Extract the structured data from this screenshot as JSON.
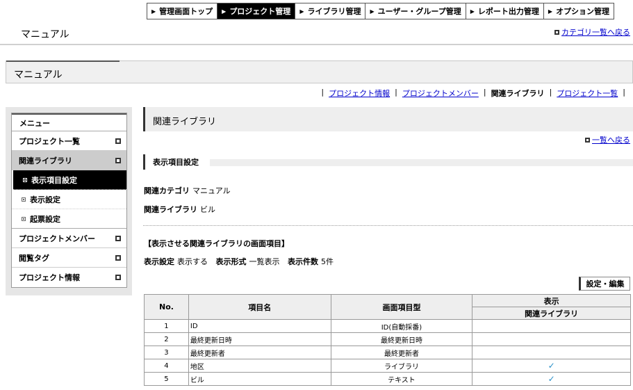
{
  "topnav": [
    {
      "label": "管理画面トップ",
      "active": false
    },
    {
      "label": "プロジェクト管理",
      "active": true
    },
    {
      "label": "ライブラリ管理",
      "active": false
    },
    {
      "label": "ユーザー・グループ管理",
      "active": false
    },
    {
      "label": "レポート出力管理",
      "active": false
    },
    {
      "label": "オプション管理",
      "active": false
    }
  ],
  "header": {
    "title": "マニュアル",
    "back_link": "カテゴリ一覧へ戻る"
  },
  "page_bar": {
    "title": "マニュアル"
  },
  "subnav": {
    "items": [
      {
        "label": "プロジェクト情報",
        "current": false
      },
      {
        "label": "プロジェクトメンバー",
        "current": false
      },
      {
        "label": "関連ライブラリ",
        "current": true
      },
      {
        "label": "プロジェクト一覧",
        "current": false
      }
    ],
    "separator": "|"
  },
  "sidebar": {
    "menu_title": "メニュー",
    "item_project_list": "プロジェクト一覧",
    "item_related_library": "関連ライブラリ",
    "sub_display_items": "表示項目設定",
    "sub_display_settings": "表示設定",
    "sub_ticket_settings": "起票設定",
    "item_project_member": "プロジェクトメンバー",
    "item_browse_tag": "閲覧タグ",
    "item_project_info": "プロジェクト情報"
  },
  "main": {
    "title": "関連ライブラリ",
    "back_link": "一覧へ戻る",
    "section_title": "表示項目設定",
    "category_label": "関連カテゴリ",
    "category_value": "マニュアル",
    "library_label": "関連ライブラリ",
    "library_value": "ビル",
    "subhead": "【表示させる関連ライブラリの画面項目】",
    "display_label": "表示設定",
    "display_value": "表示する",
    "format_label": "表示形式",
    "format_value": "一覧表示",
    "count_label": "表示件数",
    "count_value": "5件",
    "edit_button": "設定・編集"
  },
  "table": {
    "headers": {
      "no": "No.",
      "item_name": "項目名",
      "item_type": "画面項目型",
      "display": "表示",
      "display_sub": "関連ライブラリ"
    },
    "rows": [
      {
        "no": "1",
        "name": "ID",
        "type": "ID(自動採番)",
        "checked": false
      },
      {
        "no": "2",
        "name": "最終更新日時",
        "type": "最終更新日時",
        "checked": false
      },
      {
        "no": "3",
        "name": "最終更新者",
        "type": "最終更新者",
        "checked": false
      },
      {
        "no": "4",
        "name": "地区",
        "type": "ライブラリ",
        "checked": true
      },
      {
        "no": "5",
        "name": "ビル",
        "type": "テキスト",
        "checked": true
      }
    ],
    "check_glyph": "✓"
  }
}
